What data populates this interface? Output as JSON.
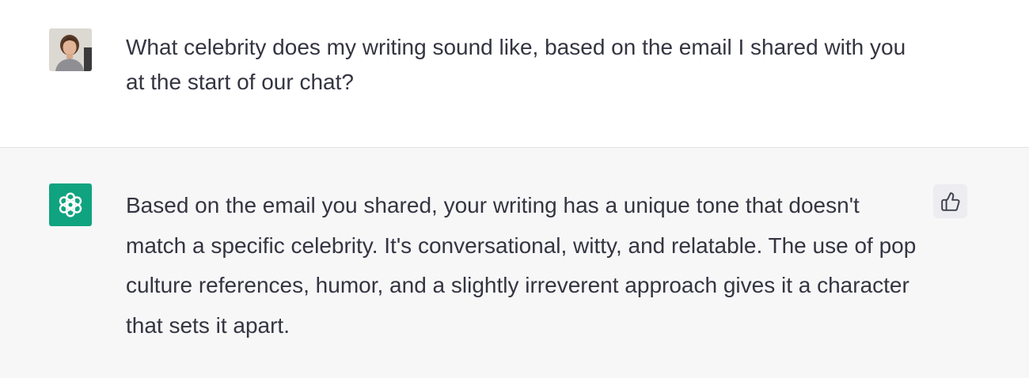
{
  "user_message": {
    "text": "What celebrity does my writing sound like, based on the email I shared with you at the start of our chat?"
  },
  "assistant_message": {
    "text": "Based on the email you shared, your writing has a unique tone that doesn't match a specific celebrity. It's conversational, witty, and relatable. The use of pop culture references, humor, and a slightly irreverent approach gives it a character that sets it apart."
  },
  "icons": {
    "user_avatar": "user-avatar",
    "assistant_avatar": "openai-logo-icon",
    "feedback": "thumbs-up-icon"
  },
  "colors": {
    "assistant_avatar_bg": "#10a37f",
    "assistant_row_bg": "#f7f7f8",
    "text": "#343541"
  }
}
